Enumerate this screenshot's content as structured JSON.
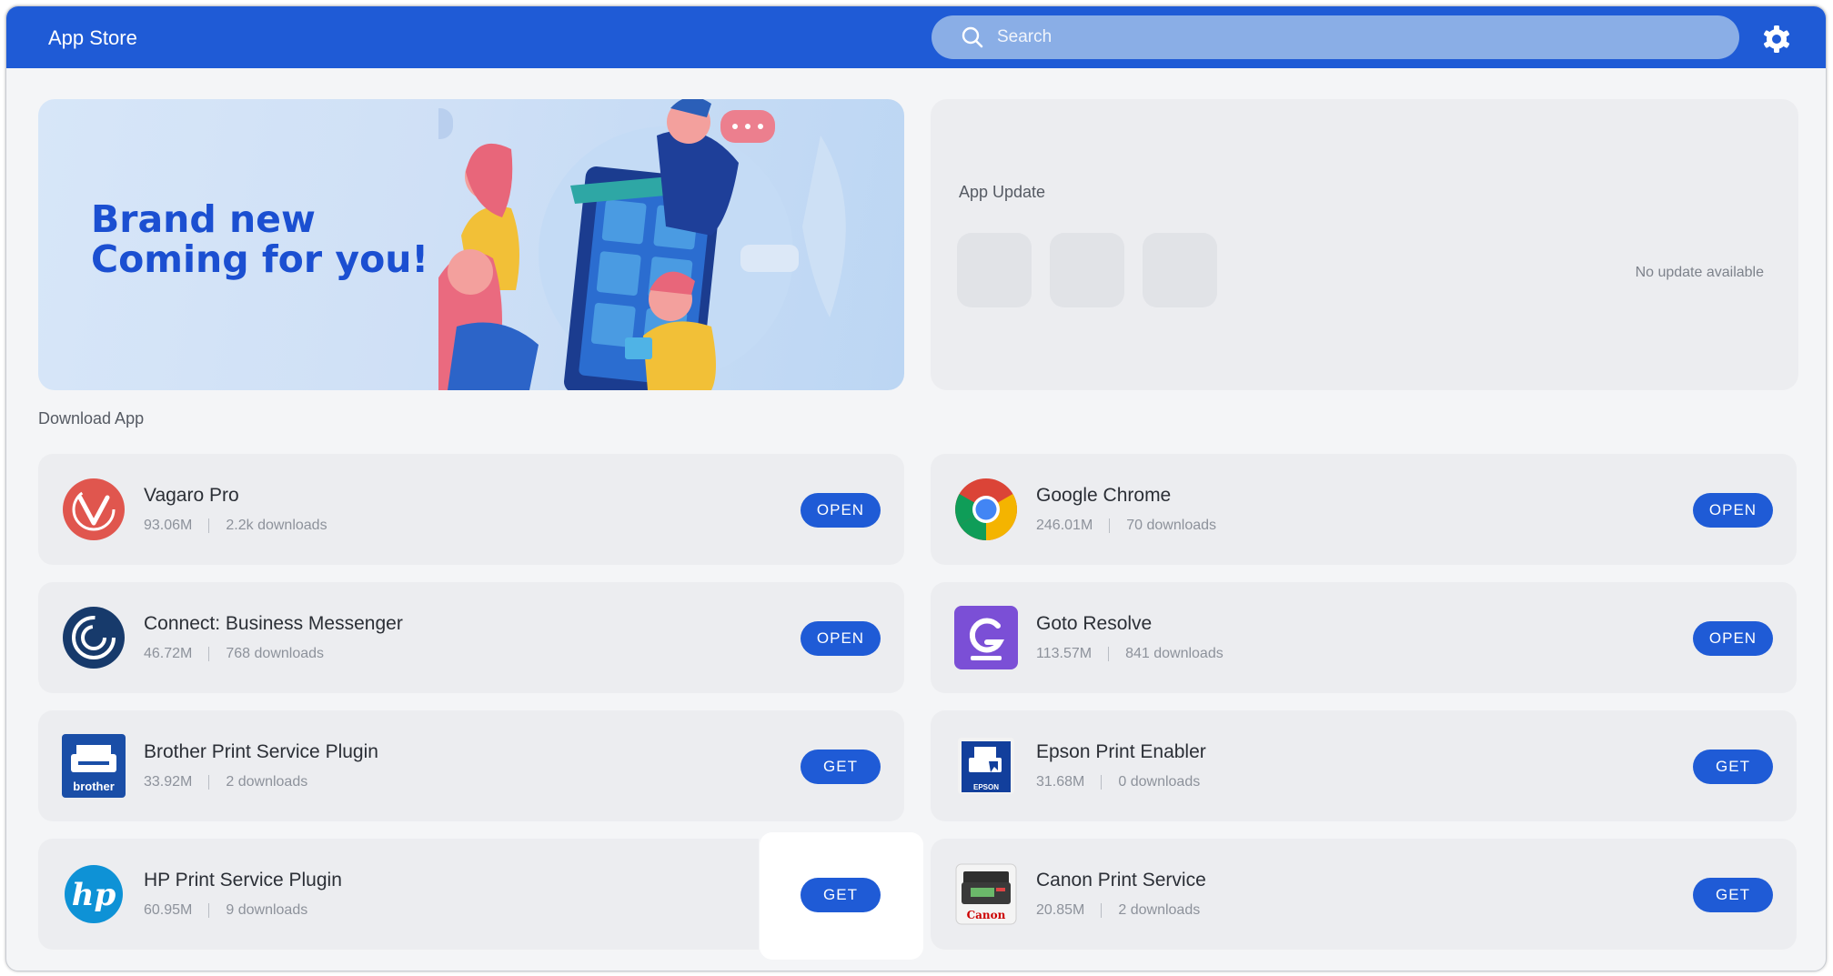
{
  "header": {
    "title": "App Store",
    "search_placeholder": "Search",
    "settings_icon": "gear-icon"
  },
  "banner": {
    "headline": "Brand new\nComing for you!"
  },
  "app_update": {
    "title": "App Update",
    "status": "No update available"
  },
  "download_section": {
    "title": "Download App"
  },
  "apps": [
    {
      "name": "Vagaro Pro",
      "size": "93.06M",
      "downloads": "2.2k downloads",
      "action": "OPEN",
      "icon": "vagaro-icon"
    },
    {
      "name": "Google Chrome",
      "size": "246.01M",
      "downloads": "70 downloads",
      "action": "OPEN",
      "icon": "chrome-icon"
    },
    {
      "name": "Connect: Business Messenger",
      "size": "46.72M",
      "downloads": "768 downloads",
      "action": "OPEN",
      "icon": "connect-icon"
    },
    {
      "name": "Goto Resolve",
      "size": "113.57M",
      "downloads": "841 downloads",
      "action": "OPEN",
      "icon": "goto-resolve-icon"
    },
    {
      "name": "Brother Print Service Plugin",
      "size": "33.92M",
      "downloads": "2 downloads",
      "action": "GET",
      "icon": "brother-icon"
    },
    {
      "name": "Epson Print Enabler",
      "size": "31.68M",
      "downloads": "0 downloads",
      "action": "GET",
      "icon": "epson-icon"
    },
    {
      "name": "HP Print Service Plugin",
      "size": "60.95M",
      "downloads": "9 downloads",
      "action": "GET",
      "icon": "hp-icon"
    },
    {
      "name": "Canon Print Service",
      "size": "20.85M",
      "downloads": "2 downloads",
      "action": "GET",
      "icon": "canon-icon"
    }
  ],
  "icon_logo_text": {
    "brother": "brother",
    "epson": "EPSON",
    "hp": "hp",
    "canon": "Canon"
  },
  "colors": {
    "accent": "#1f5bd6",
    "topbar": "#1f5bd6",
    "banner_text": "#1b4fd1"
  }
}
